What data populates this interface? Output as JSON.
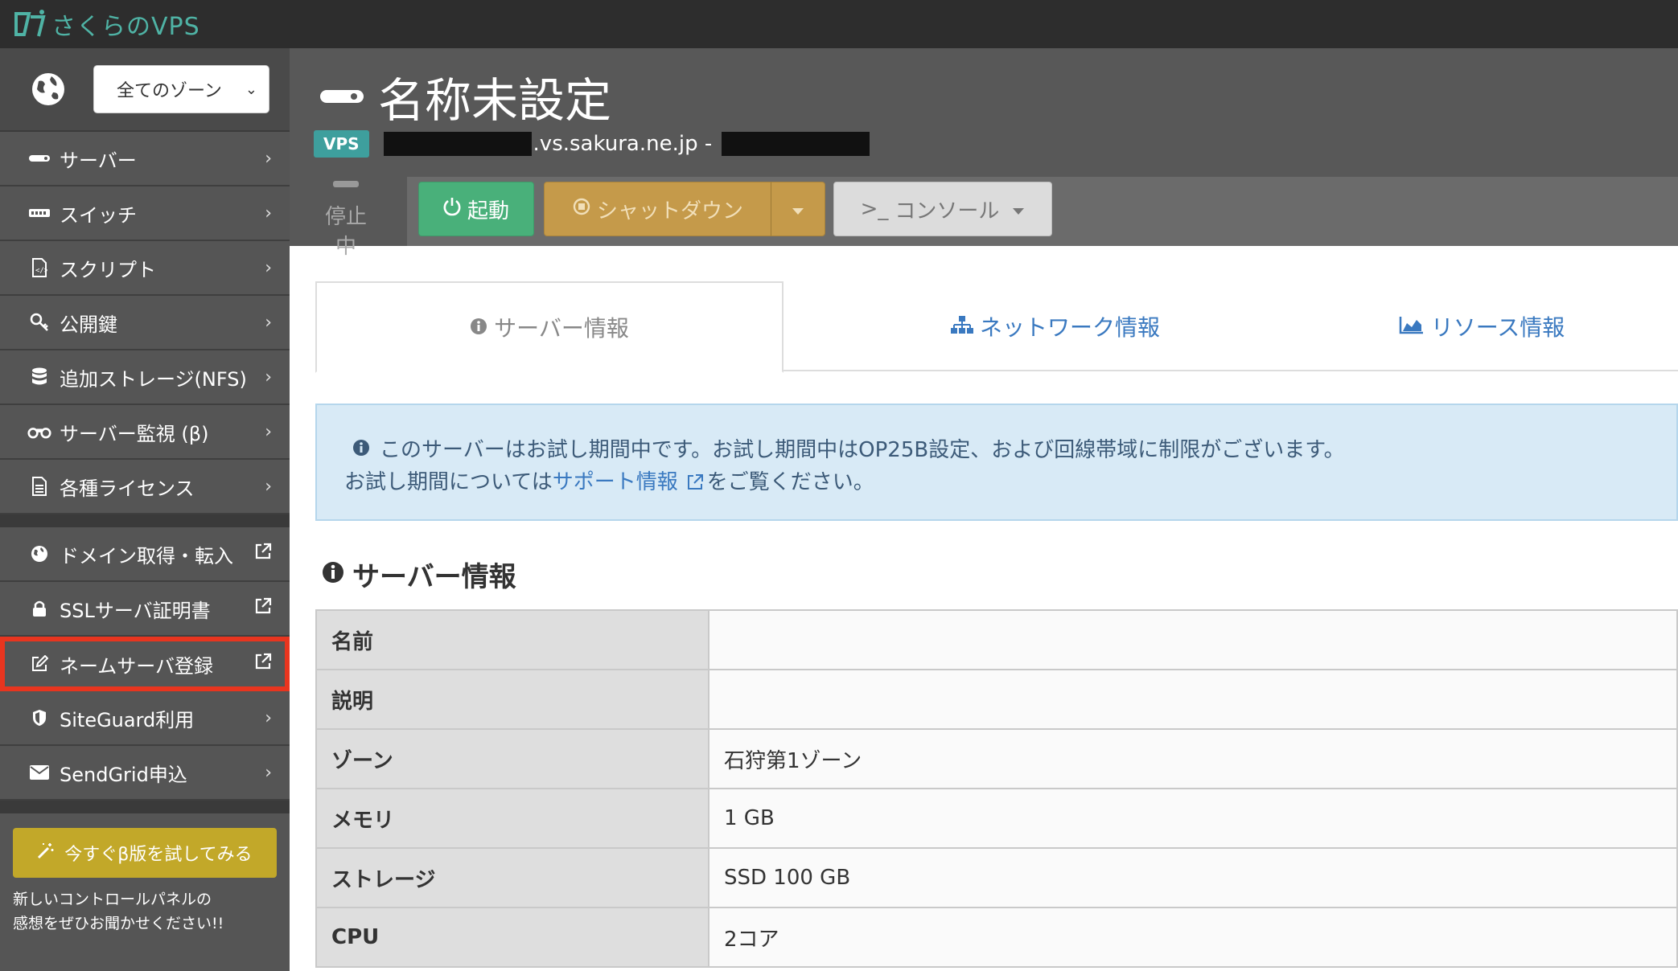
{
  "app": {
    "logo_text": "さくらのVPS"
  },
  "sidebar": {
    "zone_select": {
      "value": "全てのゾーン"
    },
    "items": [
      {
        "label": "サーバー",
        "icon": "server-icon"
      },
      {
        "label": "スイッチ",
        "icon": "switch-icon"
      },
      {
        "label": "スクリプト",
        "icon": "script-icon"
      },
      {
        "label": "公開鍵",
        "icon": "key-icon"
      },
      {
        "label": "追加ストレージ(NFS)",
        "icon": "database-icon"
      },
      {
        "label": "サーバー監視 (β)",
        "icon": "binoculars-icon"
      },
      {
        "label": "各種ライセンス",
        "icon": "document-icon"
      }
    ],
    "external_items": [
      {
        "label": "ドメイン取得・転入",
        "icon": "globe-icon"
      },
      {
        "label": "SSLサーバ証明書",
        "icon": "lock-icon"
      },
      {
        "label": "ネームサーバ登録",
        "icon": "edit-icon"
      }
    ],
    "extra_items": [
      {
        "label": "SiteGuard利用",
        "icon": "shield-icon"
      },
      {
        "label": "SendGrid申込",
        "icon": "envelope-icon"
      }
    ],
    "beta_button": "今すぐβ版を試してみる",
    "beta_note_line1": "新しいコントロールパネルの",
    "beta_note_line2": "感想をぜひお聞かせください!!"
  },
  "header": {
    "title": "名称未設定",
    "badge": "VPS",
    "hostname_suffix": ".vs.sakura.ne.jp -",
    "status": "停止中",
    "buttons": {
      "start": "起動",
      "shutdown": "シャットダウン",
      "console": "コンソール",
      "console_prefix": ">_"
    }
  },
  "tabs": [
    {
      "label": "サーバー情報"
    },
    {
      "label": "ネットワーク情報"
    },
    {
      "label": "リソース情報"
    }
  ],
  "notice": {
    "line1": "このサーバーはお試し期間中です。お試し期間中はOP25B設定、および回線帯域に制限がございます。",
    "line2_before": "お試し期間については",
    "line2_link": "サポート情報",
    "line2_after": "をご覧ください。"
  },
  "section": {
    "title": "サーバー情報"
  },
  "server_table": [
    {
      "key": "名前",
      "value": ""
    },
    {
      "key": "説明",
      "value": ""
    },
    {
      "key": "ゾーン",
      "value": "石狩第1ゾーン"
    },
    {
      "key": "メモリ",
      "value": "1 GB"
    },
    {
      "key": "ストレージ",
      "value": "SSD 100 GB"
    },
    {
      "key": "CPU",
      "value": "2コア"
    }
  ],
  "colors": {
    "accent_teal": "#3e9f9d",
    "start_green": "#49b07a",
    "shutdown_gold": "#c59a4a",
    "link_blue": "#3a79c0",
    "highlight_red": "#e8351f"
  }
}
